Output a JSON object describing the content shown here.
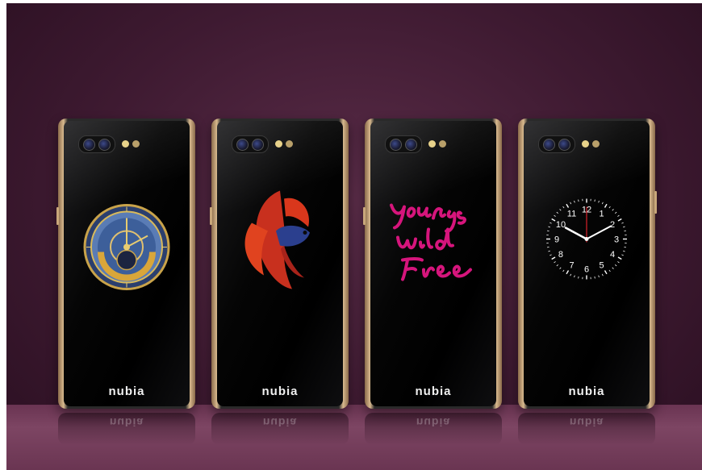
{
  "scene": {
    "background_color": "#3e1a31",
    "frame_color": "#d8b98e"
  },
  "phones": [
    {
      "display": "astronomical-clock",
      "logo": "nubia"
    },
    {
      "display": "betta-fish",
      "logo": "nubia"
    },
    {
      "display": "lettering",
      "logo": "nubia",
      "lettering_color": "#d6157c"
    },
    {
      "display": "analog-clock",
      "logo": "nubia",
      "clock_numbers": [
        "12",
        "1",
        "2",
        "3",
        "4",
        "5",
        "6",
        "7",
        "8",
        "9",
        "10",
        "11"
      ]
    }
  ]
}
